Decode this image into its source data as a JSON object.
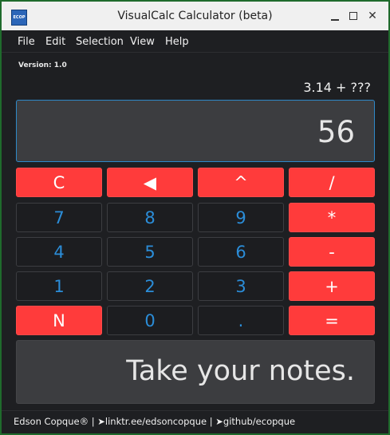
{
  "window": {
    "title": "VisualCalc Calculator (beta)",
    "icon_text": "ECOP",
    "minimize_icon": "minimize-icon",
    "maximize_icon": "maximize-icon",
    "close_icon": "close-icon",
    "close_glyph": "✕"
  },
  "menu": [
    "File",
    "Edit",
    "Selection",
    "View",
    "Help"
  ],
  "version_label": "Version: 1.0",
  "expression": "3.14 + ???",
  "display_value": "56",
  "keys": [
    {
      "label": "C",
      "style": "red"
    },
    {
      "label": "◀",
      "style": "red"
    },
    {
      "label": "^",
      "style": "red"
    },
    {
      "label": "/",
      "style": "red"
    },
    {
      "label": "7",
      "style": "dark"
    },
    {
      "label": "8",
      "style": "dark"
    },
    {
      "label": "9",
      "style": "dark"
    },
    {
      "label": "*",
      "style": "red"
    },
    {
      "label": "4",
      "style": "dark"
    },
    {
      "label": "5",
      "style": "dark"
    },
    {
      "label": "6",
      "style": "dark"
    },
    {
      "label": "-",
      "style": "red"
    },
    {
      "label": "1",
      "style": "dark"
    },
    {
      "label": "2",
      "style": "dark"
    },
    {
      "label": "3",
      "style": "dark"
    },
    {
      "label": "+",
      "style": "red"
    },
    {
      "label": "N",
      "style": "red"
    },
    {
      "label": "0",
      "style": "dark"
    },
    {
      "label": ".",
      "style": "dark"
    },
    {
      "label": "=",
      "style": "red"
    }
  ],
  "notes_text": "Take your notes.",
  "footer_text": "Edson Copque® | ➤linktr.ee/edsoncopque | ➤github/ecopque",
  "colors": {
    "accent_red": "#ff3b3b",
    "digit_blue": "#2b8dd8",
    "background": "#1e1f22",
    "display_border": "#2e89c8"
  }
}
